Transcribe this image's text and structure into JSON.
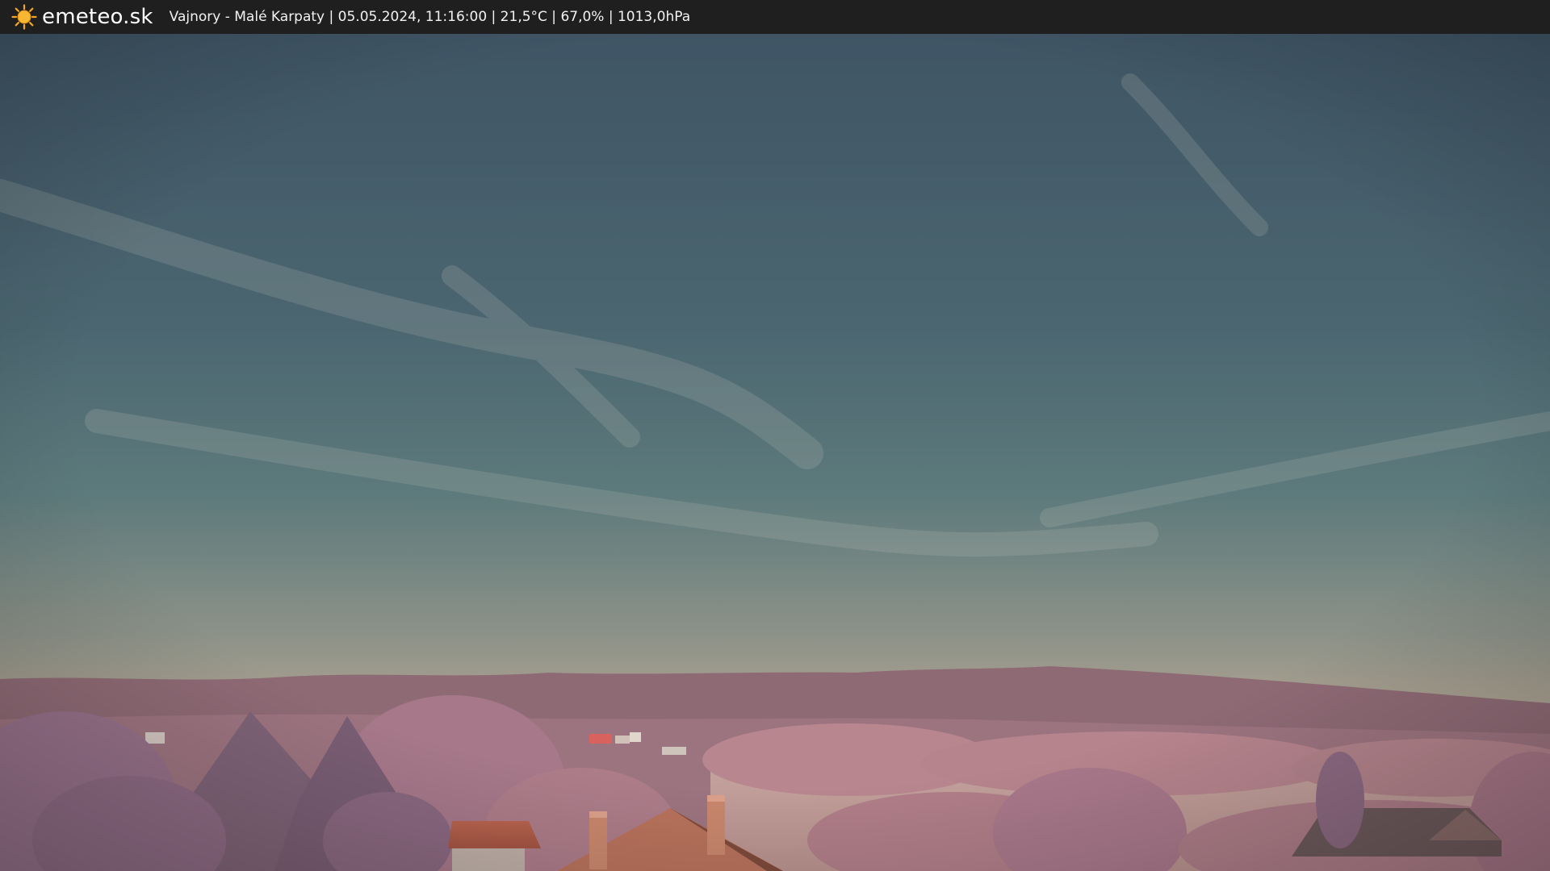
{
  "header": {
    "brand": "emeteo.sk",
    "logo_icon": "sun-icon",
    "caption": "Vajnory - Malé Karpaty | 05.05.2024, 11:16:00 | 21,5°C | 67,0% | 1013,0hPa"
  },
  "colors": {
    "bar_background": "#1f1f1f",
    "sun": "#f5a623",
    "sky_top": "#3f5666",
    "sky_horizon": "#b3a596",
    "hills": "#8c6872",
    "foliage": "#b9868e",
    "roof": "#b0584a"
  }
}
